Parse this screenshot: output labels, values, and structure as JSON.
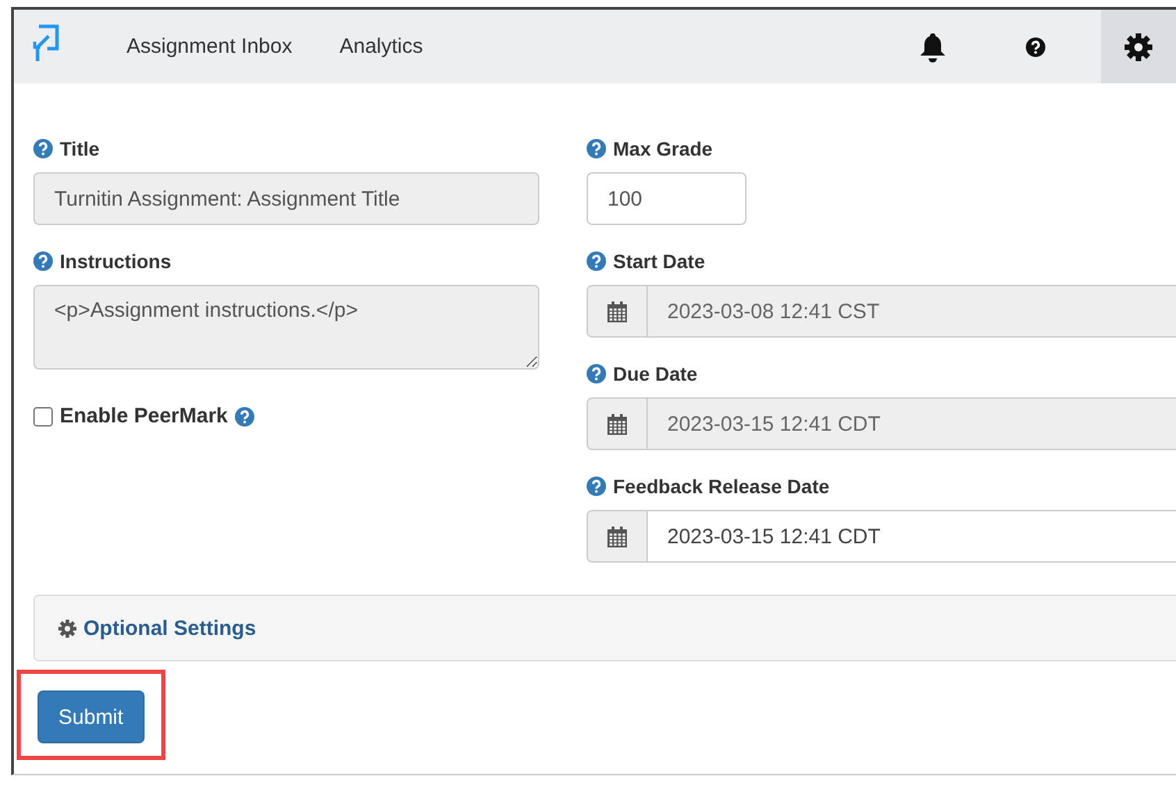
{
  "navbar": {
    "links": [
      {
        "label": "Assignment Inbox",
        "selected": false
      },
      {
        "label": "Analytics",
        "selected": false
      }
    ],
    "icons": [
      {
        "kind": "bell",
        "selected": false
      },
      {
        "kind": "help",
        "selected": false
      },
      {
        "kind": "gear",
        "selected": true
      }
    ]
  },
  "left_fields": [
    {
      "kind": "text",
      "label": "Title",
      "value": "Turnitin Assignment: Assignment Title",
      "disabled": true
    },
    {
      "kind": "textarea",
      "label": "Instructions",
      "value": "<p>Assignment instructions.</p>",
      "disabled": true
    },
    {
      "kind": "checkbox",
      "label": "Enable PeerMark",
      "checked": false
    }
  ],
  "right_fields": [
    {
      "kind": "number",
      "label": "Max Grade",
      "value": "100",
      "disabled": false
    },
    {
      "kind": "date",
      "label": "Start Date",
      "value": "2023-03-08 12:41 CST",
      "disabled": true
    },
    {
      "kind": "date",
      "label": "Due Date",
      "value": "2023-03-15 12:41 CDT",
      "disabled": true
    },
    {
      "kind": "date",
      "label": "Feedback Release Date",
      "value": "2023-03-15 12:41 CDT",
      "disabled": false
    }
  ],
  "optional_settings": {
    "label": "Optional Settings"
  },
  "submit": {
    "label": "Submit",
    "highlighted": true
  }
}
